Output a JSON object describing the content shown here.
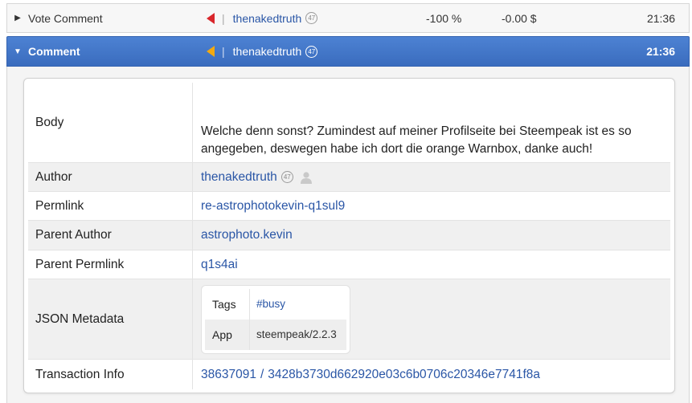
{
  "vote_row": {
    "type_label": "Vote Comment",
    "user": "thenakedtruth",
    "reputation": "47",
    "percent": "-100 %",
    "amount": "-0.00 $",
    "time": "21:36",
    "arrow_color": "#d9262b"
  },
  "comment_row": {
    "type_label": "Comment",
    "user": "thenakedtruth",
    "reputation": "47",
    "time": "21:36",
    "arrow_color": "#f2a910",
    "header_color": "#4479c9"
  },
  "details": {
    "body_label": "Body",
    "body_text": "Welche denn sonst? Zumindest auf meiner Profilseite bei Steempeak ist es so angegeben, deswegen habe ich dort die orange Warnbox, danke auch!",
    "author_label": "Author",
    "author": "thenakedtruth",
    "author_reputation": "47",
    "permlink_label": "Permlink",
    "permlink": "re-astrophotokevin-q1sul9",
    "parent_author_label": "Parent Author",
    "parent_author": "astrophoto.kevin",
    "parent_permlink_label": "Parent Permlink",
    "parent_permlink": "q1s4ai",
    "json_metadata_label": "JSON Metadata",
    "json_metadata": {
      "tags_label": "Tags",
      "tags_value": "#busy",
      "app_label": "App",
      "app_value": "steempeak/2.2.3"
    },
    "transaction_label": "Transaction Info",
    "block_number": "38637091",
    "tx_separator": "/",
    "tx_hash": "3428b3730d662920e03c6b0706c20346e7741f8a"
  },
  "icons": {
    "caret_collapsed": "caret-right-icon",
    "caret_expanded": "caret-down-icon",
    "vote_direction": "arrow-left-icon",
    "author_profile": "user-icon"
  }
}
